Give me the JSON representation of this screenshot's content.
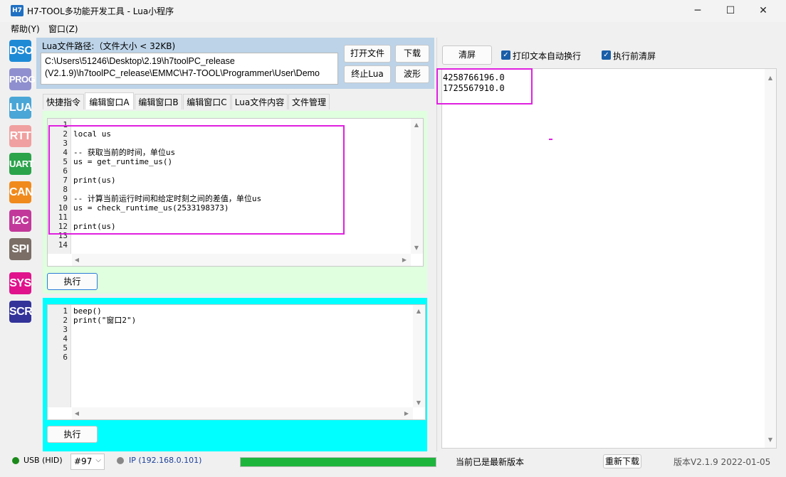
{
  "window": {
    "title": "H7-TOOL多功能开发工具 - Lua小程序",
    "app_icon": "H7",
    "minimize": "─",
    "maximize": "☐",
    "close": "✕"
  },
  "menu": {
    "help": "帮助(Y)",
    "window": "窗口(Z)"
  },
  "sidebar": [
    {
      "label": "DSO",
      "color": "#1e8ad6"
    },
    {
      "label": "PROG",
      "color": "#8f8fcf"
    },
    {
      "label": "LUA",
      "color": "#4aa6d6"
    },
    {
      "label": "RTT",
      "color": "#f0a0a0"
    },
    {
      "label": "UART",
      "color": "#2aa34a"
    },
    {
      "label": "CAN",
      "color": "#f08a1c"
    },
    {
      "label": "I2C",
      "color": "#c2389a"
    },
    {
      "label": "SPI",
      "color": "#7a6e66"
    },
    {
      "label": "SYS",
      "color": "#e0138c"
    },
    {
      "label": "SCR",
      "color": "#33339a"
    }
  ],
  "lua_file": {
    "path_label": "Lua文件路径:（文件大小 < 32KB)",
    "path_line1": "C:\\Users\\51246\\Desktop\\2.19\\h7toolPC_release",
    "path_line2": "(V2.1.9)\\h7toolPC_release\\EMMC\\H7-TOOL\\Programmer\\User\\Demo",
    "open_file": "打开文件",
    "download": "下载",
    "stop_lua": "终止Lua",
    "waveform": "波形"
  },
  "tabs": [
    "快捷指令",
    "编辑窗口A",
    "编辑窗口B",
    "编辑窗口C",
    "Lua文件内容",
    "文件管理"
  ],
  "editor_a": {
    "line_numbers": "1\n2\n3\n4\n5\n6\n7\n8\n9\n10\n11\n12\n13\n14",
    "code": "\nlocal us\n\n-- 获取当前的时间，单位us\nus = get_runtime_us()\n\nprint(us)\n\n-- 计算当前运行时间和给定时刻之间的差值，单位us\nus = check_runtime_us(2533198373)\n\nprint(us)\n\n",
    "run": "执行"
  },
  "editor_b": {
    "line_numbers": "1\n2\n3\n4\n5\n6",
    "code": "beep()\nprint(\"窗口2\")\n\n\n\n",
    "run": "执行"
  },
  "output": {
    "clear": "清屏",
    "auto_wrap": "打印文本自动换行",
    "auto_wrap_checked": true,
    "clear_before_run": "执行前清屏",
    "clear_before_run_checked": true,
    "text": "4258766196.0\n1725567910.0"
  },
  "status": {
    "usb": "USB (HID)",
    "device": "#97",
    "ip": "IP (192.168.0.101)",
    "progress": 1.0,
    "version_msg": "当前已是最新版本",
    "update": "重新下载",
    "build": "版本V2.1.9 2022-01-05"
  },
  "colors": {
    "accent_highlight": "#e020e0",
    "pane_a": "#dfffdf",
    "pane_b": "#00ffff",
    "progress": "#1db53c"
  }
}
